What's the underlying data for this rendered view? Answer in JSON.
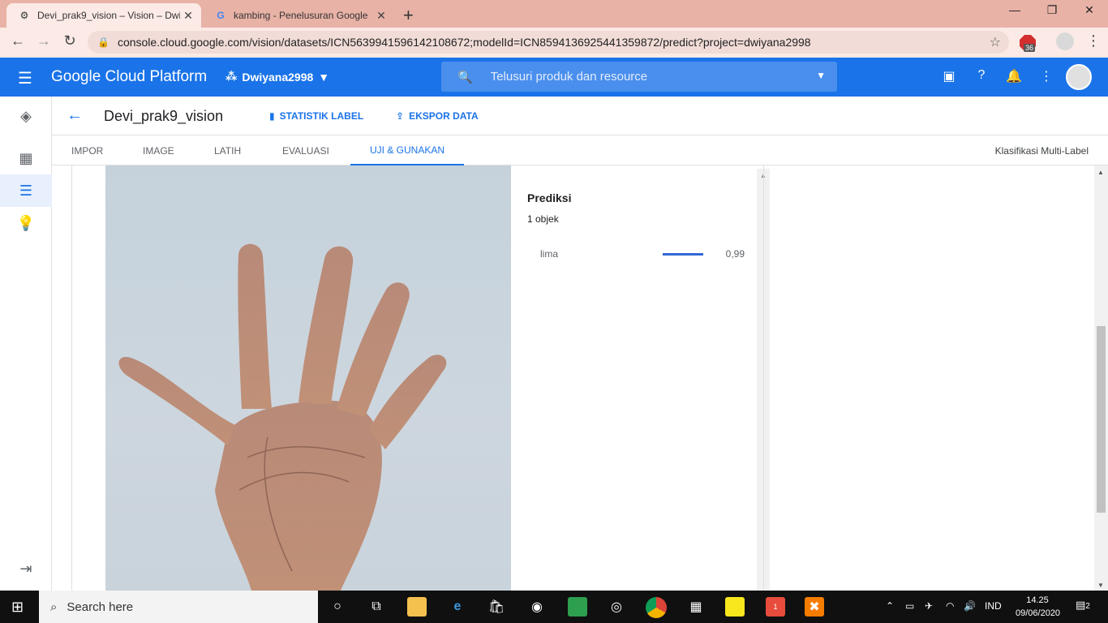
{
  "browser": {
    "tabs": [
      {
        "title": "Devi_prak9_vision – Vision – Dwiy",
        "active": true
      },
      {
        "title": "kambing - Penelusuran Google",
        "active": false
      }
    ],
    "url": "console.cloud.google.com/vision/datasets/ICN5639941596142108672;modelId=ICN8594136925441359872/predict?project=dwiyana2998",
    "extension_badge": "36"
  },
  "gcp": {
    "brand": "Google Cloud Platform",
    "project": "Dwiyana2998",
    "search_placeholder": "Telusuri produk dan resource",
    "accent": "#1a73e8"
  },
  "page": {
    "title": "Devi_prak9_vision",
    "actions": {
      "label_stats": "STATISTIK LABEL",
      "export": "EKSPOR DATA"
    },
    "tabs": [
      {
        "label": "IMPOR"
      },
      {
        "label": "IMAGE"
      },
      {
        "label": "LATIH"
      },
      {
        "label": "EVALUASI"
      },
      {
        "label": "UJI & GUNAKAN"
      }
    ],
    "selected_tab": "UJI & GUNAKAN",
    "mode": "Klasifikasi Multi-Label"
  },
  "prediction": {
    "title": "Prediksi",
    "count": "1 objek",
    "items": [
      {
        "label": "lima",
        "score": "0,99",
        "score_value": 0.99
      }
    ]
  },
  "taskbar": {
    "search_placeholder": "Search here",
    "language": "IND",
    "time": "14.25",
    "date": "09/06/2020",
    "notifications": "2",
    "app_badge": "1"
  }
}
